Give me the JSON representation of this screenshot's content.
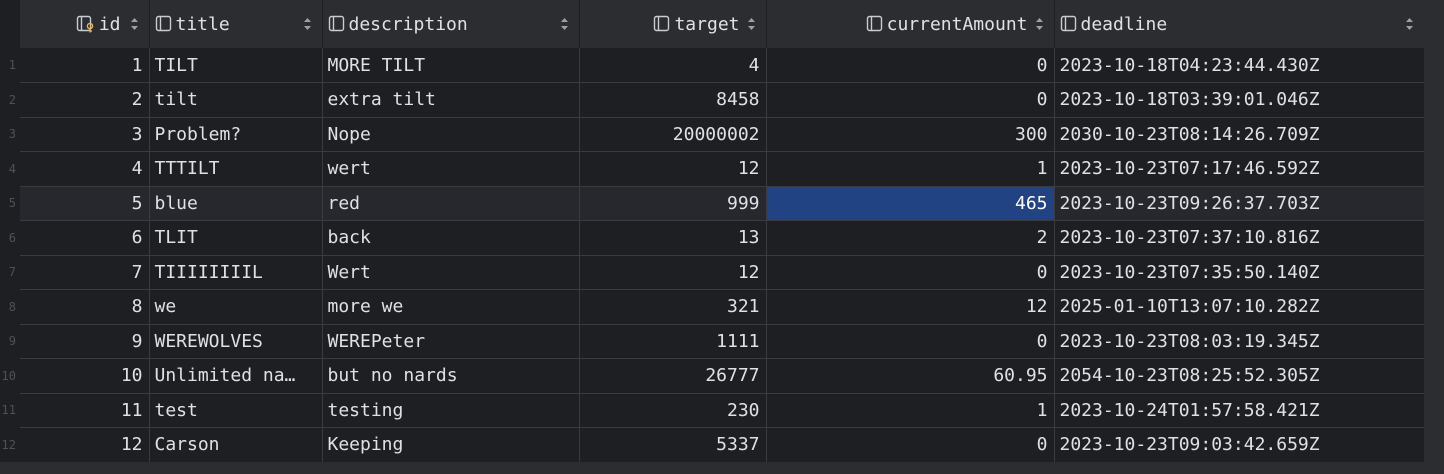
{
  "columns": [
    {
      "key": "id",
      "label": "id",
      "icon": "primary-key-column-icon"
    },
    {
      "key": "title",
      "label": "title",
      "icon": "column-icon"
    },
    {
      "key": "description",
      "label": "description",
      "icon": "column-icon"
    },
    {
      "key": "target",
      "label": "target",
      "icon": "column-icon"
    },
    {
      "key": "currentAmount",
      "label": "currentAmount",
      "icon": "column-icon"
    },
    {
      "key": "deadline",
      "label": "deadline",
      "icon": "column-icon"
    }
  ],
  "row_numbers": [
    "1",
    "2",
    "3",
    "4",
    "5",
    "6",
    "7",
    "8",
    "9",
    "10",
    "11",
    "12"
  ],
  "rows": [
    {
      "id": "1",
      "title": "TILT",
      "description": "MORE TILT",
      "target": "4",
      "currentAmount": "0",
      "deadline": "2023-10-18T04:23:44.430Z"
    },
    {
      "id": "2",
      "title": "tilt",
      "description": "extra tilt",
      "target": "8458",
      "currentAmount": "0",
      "deadline": "2023-10-18T03:39:01.046Z"
    },
    {
      "id": "3",
      "title": "Problem?",
      "description": "Nope",
      "target": "20000002",
      "currentAmount": "300",
      "deadline": "2030-10-23T08:14:26.709Z"
    },
    {
      "id": "4",
      "title": "TTTILT",
      "description": "wert",
      "target": "12",
      "currentAmount": "1",
      "deadline": "2023-10-23T07:17:46.592Z"
    },
    {
      "id": "5",
      "title": "blue",
      "description": "red",
      "target": "999",
      "currentAmount": "465",
      "deadline": "2023-10-23T09:26:37.703Z"
    },
    {
      "id": "6",
      "title": "TLIT",
      "description": "back",
      "target": "13",
      "currentAmount": "2",
      "deadline": "2023-10-23T07:37:10.816Z"
    },
    {
      "id": "7",
      "title": "TIIIIIIIIL",
      "description": "Wert",
      "target": "12",
      "currentAmount": "0",
      "deadline": "2023-10-23T07:35:50.140Z"
    },
    {
      "id": "8",
      "title": "we",
      "description": "more we",
      "target": "321",
      "currentAmount": "12",
      "deadline": "2025-01-10T13:07:10.282Z"
    },
    {
      "id": "9",
      "title": "WEREWOLVES",
      "description": "WEREPeter",
      "target": "1111",
      "currentAmount": "0",
      "deadline": "2023-10-23T08:03:19.345Z"
    },
    {
      "id": "10",
      "title": "Unlimited na…",
      "description": "but no nards",
      "target": "26777",
      "currentAmount": "60.95",
      "deadline": "2054-10-23T08:25:52.305Z"
    },
    {
      "id": "11",
      "title": "test",
      "description": "testing",
      "target": "230",
      "currentAmount": "1",
      "deadline": "2023-10-24T01:57:58.421Z"
    },
    {
      "id": "12",
      "title": "Carson",
      "description": "Keeping",
      "target": "5337",
      "currentAmount": "0",
      "deadline": "2023-10-23T09:03:42.659Z"
    }
  ],
  "selection": {
    "row": 5,
    "column": "currentAmount"
  },
  "colors": {
    "background": "#1e1f22",
    "header": "#2b2d30",
    "text": "#dfe1e5",
    "selected_cell": "#214283",
    "selected_row": "#26282e",
    "primary_key_accent": "#e8b64d"
  }
}
